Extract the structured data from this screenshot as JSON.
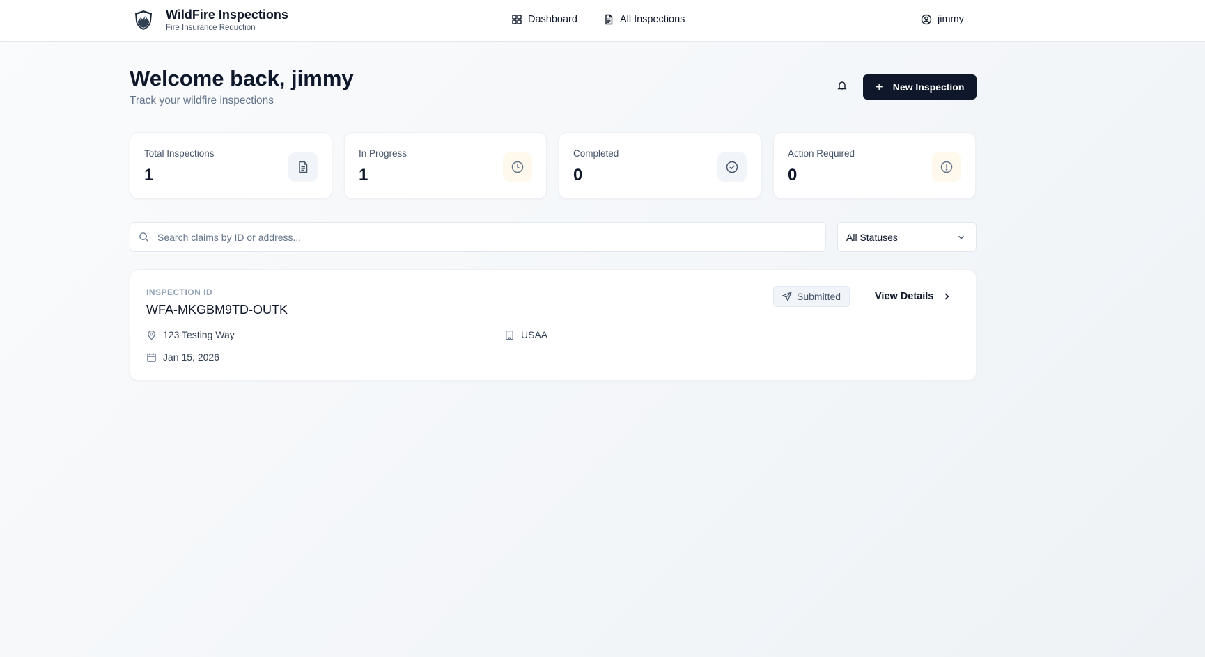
{
  "header": {
    "brand_title": "WildFire Inspections",
    "brand_subtitle": "Fire Insurance Reduction",
    "nav": [
      {
        "label": "Dashboard",
        "icon": "grid-icon"
      },
      {
        "label": "All Inspections",
        "icon": "document-icon"
      }
    ],
    "user": "jimmy"
  },
  "welcome": {
    "title": "Welcome back, jimmy",
    "subtitle": "Track your wildfire inspections",
    "new_button": "New Inspection"
  },
  "stats": [
    {
      "label": "Total Inspections",
      "value": "1",
      "icon": "document-icon",
      "icon_bg": "#f1f5f9",
      "icon_color": "#475569"
    },
    {
      "label": "In Progress",
      "value": "1",
      "icon": "clock-icon",
      "icon_bg": "#fef9ec",
      "icon_color": "#64748b"
    },
    {
      "label": "Completed",
      "value": "0",
      "icon": "check-circle-icon",
      "icon_bg": "#f1f5f9",
      "icon_color": "#475569"
    },
    {
      "label": "Action Required",
      "value": "0",
      "icon": "alert-circle-icon",
      "icon_bg": "#fef9ec",
      "icon_color": "#64748b"
    }
  ],
  "search": {
    "placeholder": "Search claims by ID or address..."
  },
  "filter": {
    "selected": "All Statuses"
  },
  "inspection": {
    "id_label": "INSPECTION ID",
    "id": "WFA-MKGBM9TD-OUTK",
    "address": "123 Testing Way",
    "insurer": "USAA",
    "date": "Jan 15, 2026",
    "status": "Submitted",
    "view_label": "View Details"
  },
  "colors": {
    "primary": "#0f172a",
    "muted_text": "#64748b",
    "card_border": "#eef0f3"
  }
}
